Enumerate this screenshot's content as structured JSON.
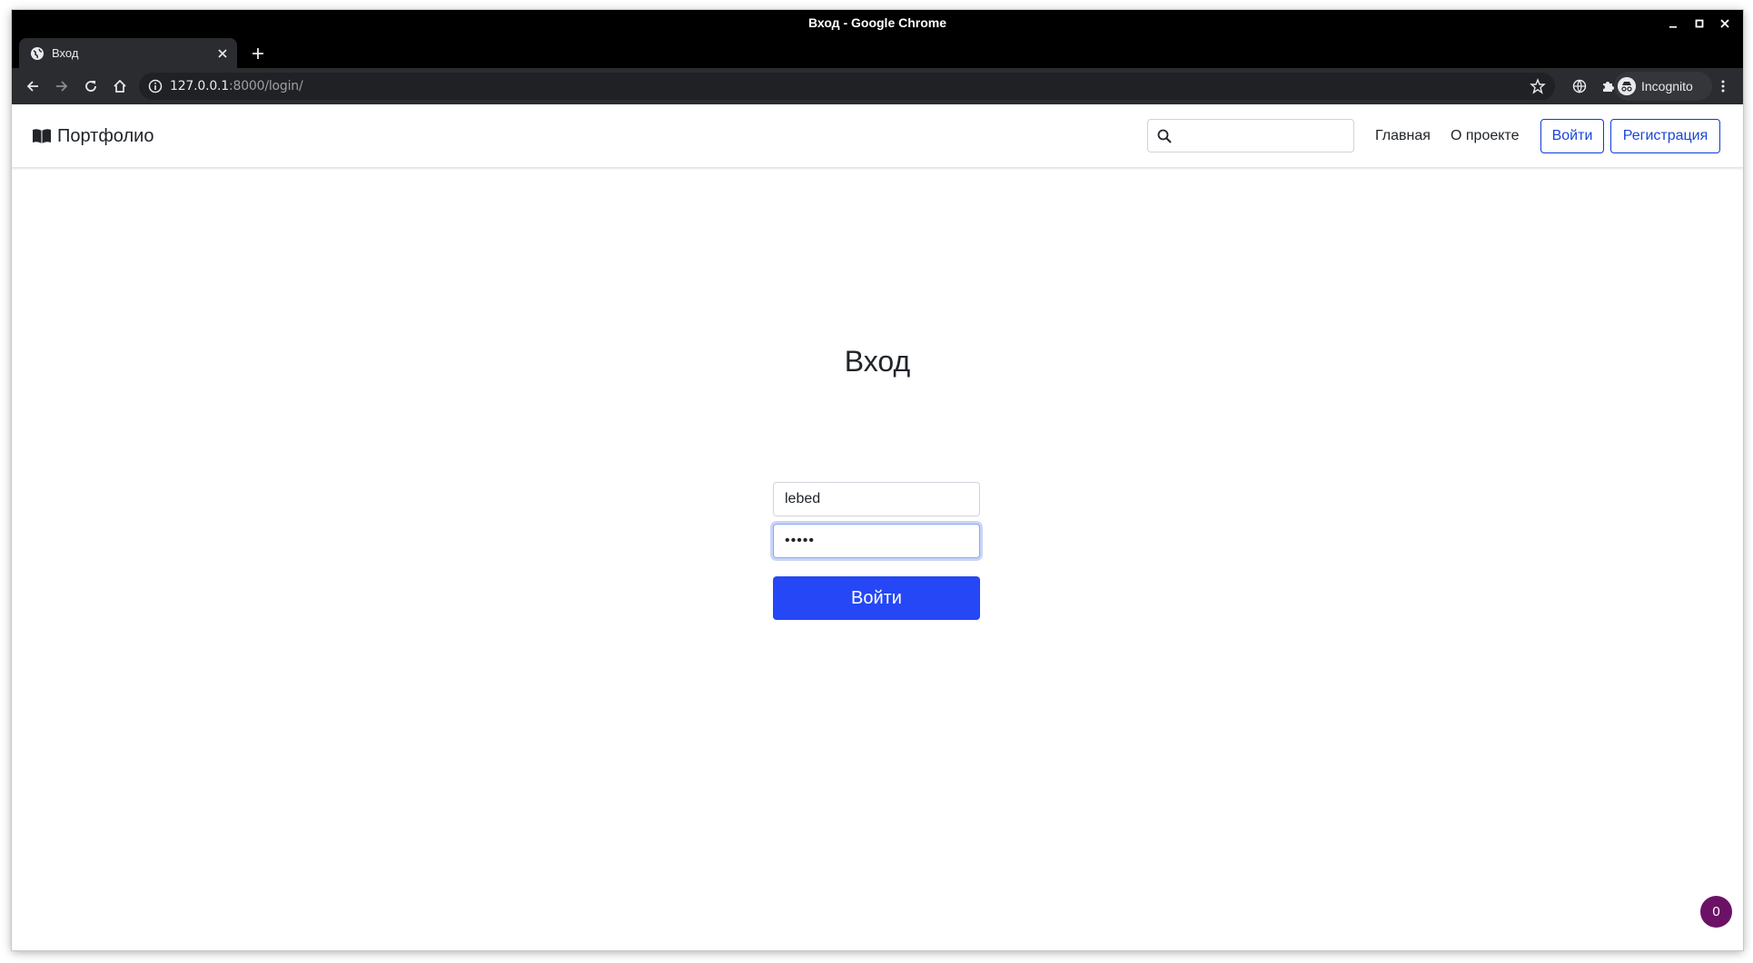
{
  "window": {
    "title": "Вход - Google Chrome"
  },
  "tab": {
    "title": "Вход"
  },
  "address_bar": {
    "host": "127.0.0.1",
    "rest": ":8000/login/"
  },
  "profile": {
    "label": "Incognito"
  },
  "navbar": {
    "brand": "Портфолио",
    "search_value": "",
    "links": [
      "Главная",
      "О проекте"
    ],
    "login_button": "Войти",
    "register_button": "Регистрация"
  },
  "login_form": {
    "title": "Вход",
    "username_value": "lebed",
    "password_value": "•••••",
    "submit_label": "Войти"
  },
  "floating_badge": {
    "count": "0"
  },
  "colors": {
    "primary": "#2547f5",
    "outline_blue": "#1a46d8",
    "badge": "#6b1266",
    "chrome_dark": "#2b2c2f"
  }
}
